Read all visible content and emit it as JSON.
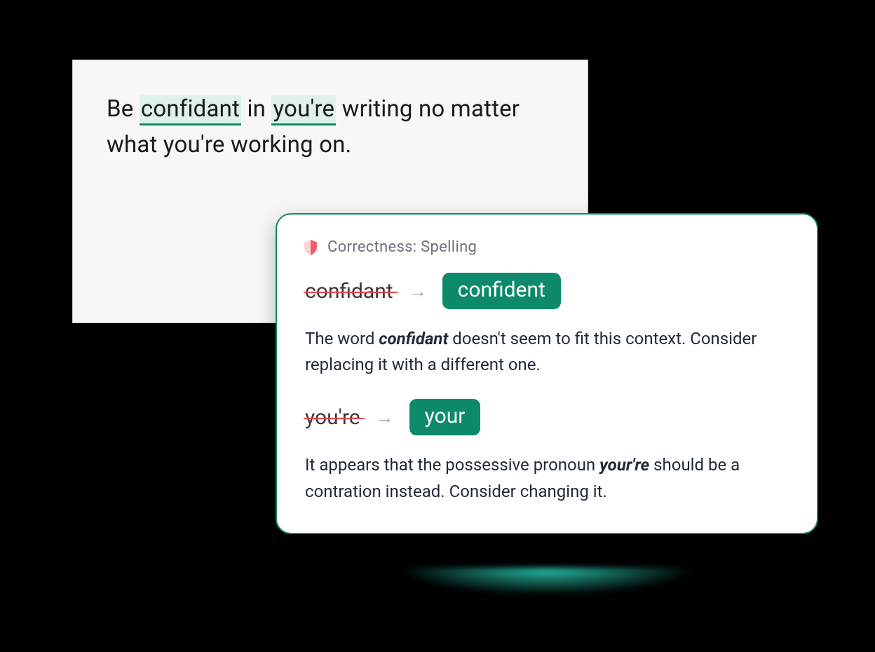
{
  "colors": {
    "accent_green": "#0d8a6a",
    "highlight_bg": "#dff1ed",
    "strike_red": "#e5484d",
    "header_gray": "#6b7280",
    "bg_black": "#000000"
  },
  "editor": {
    "pre1": "Be ",
    "error1": "confidant",
    "mid1": " in ",
    "error2": "you're",
    "post": " writing no matter what you're working on."
  },
  "suggestion": {
    "icon": "shield-icon",
    "category_label": "Correctness: Spelling",
    "items": [
      {
        "original": "confidant",
        "arrow": "→",
        "replacement": "confident",
        "explain_pre": "The word ",
        "explain_em": "confidant",
        "explain_post": " doesn't seem to fit this context. Consider replacing it with a different one."
      },
      {
        "original": "you're",
        "arrow": "→",
        "replacement": "your",
        "explain_pre": "It appears that the possessive pronoun ",
        "explain_em": "your're",
        "explain_post": " should be a contration instead. Consider changing it."
      }
    ]
  }
}
